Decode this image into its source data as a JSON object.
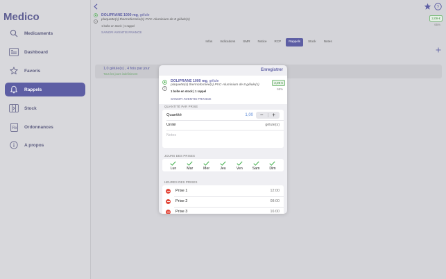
{
  "app": {
    "title": "Medico"
  },
  "sidebar": {
    "items": [
      {
        "label": "Medicaments",
        "icon": "search-icon"
      },
      {
        "label": "Dashboard",
        "icon": "dashboard-icon"
      },
      {
        "label": "Favoris",
        "icon": "star-icon"
      },
      {
        "label": "Rappels",
        "icon": "bell-icon",
        "active": true
      },
      {
        "label": "Stock",
        "icon": "stock-icon"
      },
      {
        "label": "Ordonnances",
        "icon": "prescription-icon"
      },
      {
        "label": "A propos",
        "icon": "info-icon"
      }
    ]
  },
  "background": {
    "drug": {
      "name": "DOLIPRANE 1000 mg",
      "form": ", gélule",
      "packaging": "plaquette(s) thermoformée(s) PVC-Aluminium de 8 gélule(s)",
      "stock": "1 boîte en stock | 1 rappel",
      "lab": "SANOFI AVENTIS FRANCE",
      "price": "2,09 €",
      "reimbursement": "65%"
    },
    "tabs": [
      "Infos",
      "Indications",
      "SMR",
      "Notice",
      "RCP",
      "Rappels",
      "Stock",
      "Notes"
    ],
    "active_tab": "Rappels",
    "reminder": {
      "main": "1,0 gélule(s) , 4 fois par jour",
      "sub": "Tous les jours indefiniment"
    }
  },
  "modal": {
    "save_label": "Enregistrer",
    "drug": {
      "name": "DOLIPRANE 1000 mg",
      "form": ", gélule",
      "packaging": "plaquette(s) thermoformée(s) PVC-Aluminium de 8 gélule(s)",
      "stock": "1 boîte en stock | 1 rappel",
      "lab": "SANOFI AVENTIS FRANCE",
      "price": "2,09 €",
      "reimbursement": "65%"
    },
    "quantity_section": "QUANTITÉ PAR PRISE",
    "quantity_label": "Quantité",
    "quantity_value": "1,00",
    "unit_label": "Unité",
    "unit_value": "gélule(s)",
    "notes_placeholder": "Notes",
    "days_section": "JOURS DES PRISES",
    "days": [
      "Lun",
      "Mar",
      "Mer",
      "Jeu",
      "Ven",
      "Sam",
      "Dim"
    ],
    "hours_section": "HEURES DES PRISES",
    "prises": [
      {
        "label": "Prise 1",
        "time": "12:00"
      },
      {
        "label": "Prise 2",
        "time": "08:00"
      },
      {
        "label": "Prise 3",
        "time": "16:00"
      }
    ]
  },
  "colors": {
    "accent": "#5d5ea4",
    "check": "#3fae4a",
    "delete": "#e2473a",
    "price_green": "#3b8a3b"
  }
}
